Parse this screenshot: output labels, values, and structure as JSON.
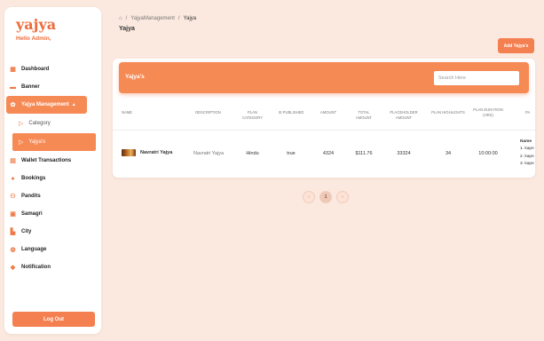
{
  "brand": {
    "logo": "yajya",
    "greeting": "Hello Admin,"
  },
  "sidebar": {
    "items": [
      {
        "label": "Dashboard",
        "icon": "dashboard-icon"
      },
      {
        "label": "Banner",
        "icon": "banner-icon"
      },
      {
        "label": "Yajya Management",
        "icon": "yajya-icon"
      },
      {
        "label": "Wallet Transactions",
        "icon": "wallet-icon"
      },
      {
        "label": "Bookings",
        "icon": "bookings-icon"
      },
      {
        "label": "Pandits",
        "icon": "pandits-icon"
      },
      {
        "label": "Samagri",
        "icon": "samagri-icon"
      },
      {
        "label": "City",
        "icon": "city-icon"
      },
      {
        "label": "Language",
        "icon": "language-icon"
      },
      {
        "label": "Notification",
        "icon": "notification-icon"
      }
    ],
    "sub_items": [
      {
        "label": "Category"
      },
      {
        "label": "Yajya's"
      }
    ],
    "logout": "Log Out"
  },
  "breadcrumb": {
    "sep": "/",
    "parent": "YajyaManagement",
    "current": "Yajya"
  },
  "page_title": "Yajya",
  "add_button": "Add Yajya's",
  "table_card": {
    "title": "Yajya's",
    "search_placeholder": "Search Here"
  },
  "table": {
    "headers": {
      "name": "NAME",
      "description": "DESCRIPTION",
      "plan_category": "PLAN CATEGORY",
      "is_published": "IS PUBLISHED",
      "amount": "AMOUNT",
      "total_amount": "TOTAL AMOUNT",
      "placeholder_amount": "PLACEHOLDER AMOUNT",
      "plan_highlights": "PLAN HIGHLIGHTS",
      "plan_duration": "PLAN DURATION (HRS)",
      "pa": "PA"
    },
    "row": {
      "name": "Navratri Yajya",
      "description": "Navratri Yajya",
      "plan_category": "Hindu",
      "is_published": "true",
      "amount": "4324",
      "total_amount": "$111.76",
      "placeholder_amount": "33324",
      "plan_highlights": "34",
      "plan_duration": "10:00:00",
      "pa_title": "Name",
      "pa_items": [
        "1. kape",
        "2. kape",
        "3. kape"
      ]
    }
  },
  "pagination": {
    "prev": "‹",
    "current": "1",
    "next": "›"
  },
  "colors": {
    "accent": "#f68a55",
    "brand": "#ee6c3b",
    "background": "#fbe9df"
  }
}
